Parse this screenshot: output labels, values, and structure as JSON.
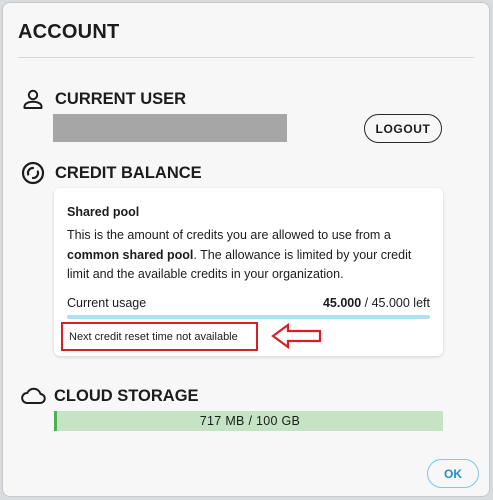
{
  "dialog": {
    "title": "ACCOUNT"
  },
  "current_user": {
    "heading": "CURRENT USER",
    "icon": "person-icon",
    "logout_label": "LOGOUT"
  },
  "credit_balance": {
    "heading": "CREDIT BALANCE",
    "icon": "circle-arrows-icon",
    "card": {
      "title": "Shared pool",
      "desc_part1": "This is the amount of credits you are allowed to use from a ",
      "desc_bold": "common shared pool",
      "desc_part2": ". The allowance is limited by your credit limit and the available credits in your organization.",
      "usage_label": "Current usage",
      "usage_used": "45.000",
      "usage_rest": " / 45.000 left",
      "usage_fraction": 1.0,
      "reset_text": "Next credit reset time not available"
    }
  },
  "cloud_storage": {
    "heading": "CLOUD STORAGE",
    "icon": "cloud-icon",
    "usage_text": "717 MB / 100 GB",
    "bar_color": "#c6e3c6",
    "accent_color": "#4caf50"
  },
  "footer": {
    "ok_label": "OK"
  },
  "colors": {
    "highlight_red": "#d81f26",
    "ok_accent": "#1f8fc8",
    "usage_bar": "#aee0f2"
  }
}
